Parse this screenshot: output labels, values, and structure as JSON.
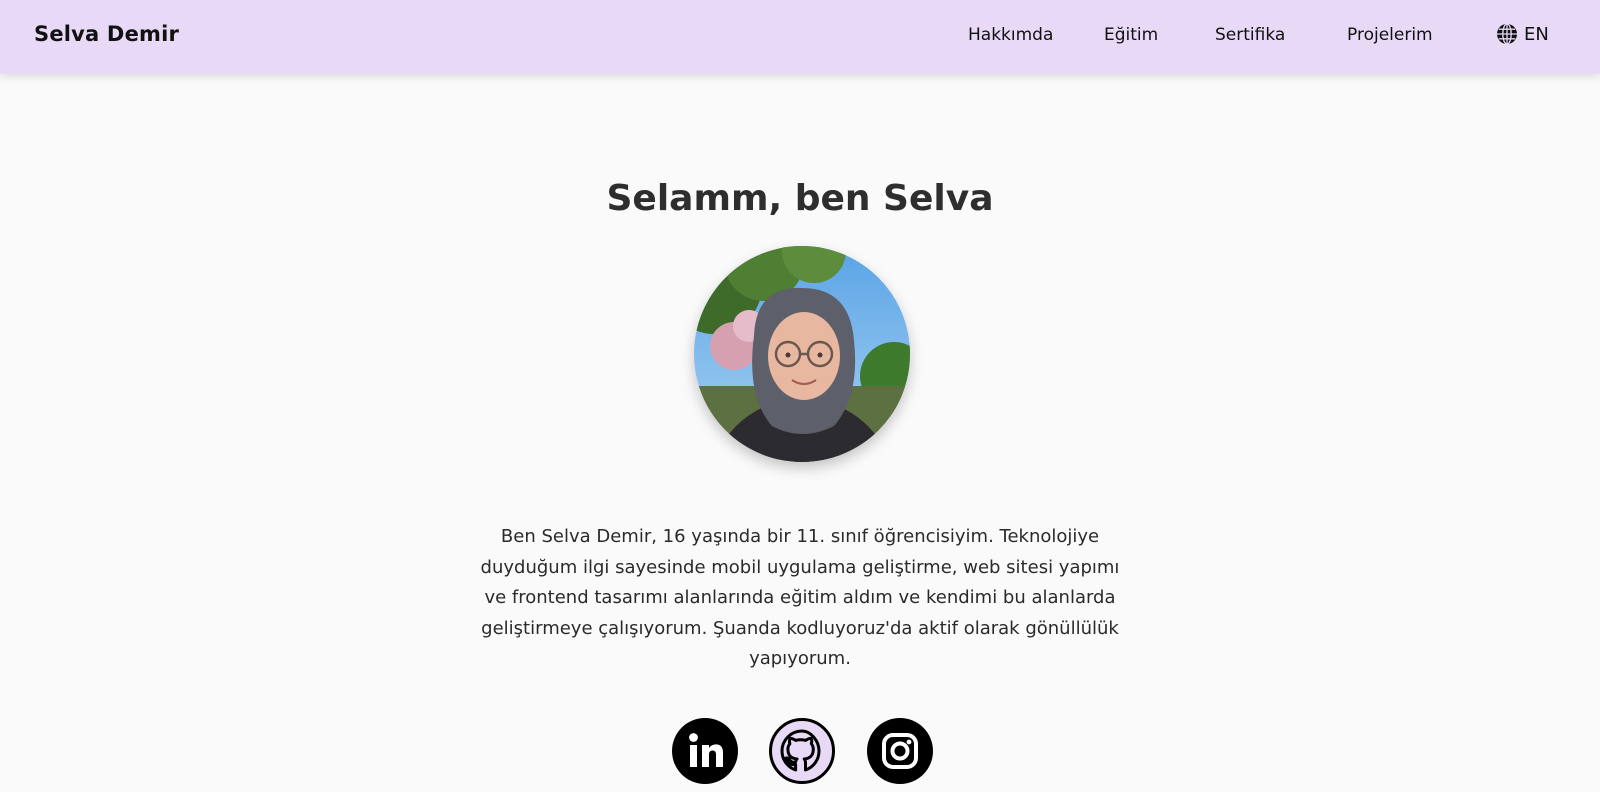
{
  "navbar": {
    "brand": "Selva Demir",
    "links": [
      "Hakkımda",
      "Eğitim",
      "Sertifika",
      "Projelerim"
    ],
    "language": {
      "label": "EN",
      "icon": "globe-icon"
    }
  },
  "hero": {
    "title": "Selamm, ben Selva",
    "bio": "Ben Selva Demir, 16 yaşında bir 11. sınıf öğrencisiyim. Teknolojiye duyduğum ilgi sayesinde mobil uygulama geliştirme, web sitesi yapımı ve frontend tasarımı alanlarında eğitim aldım ve kendimi bu alanlarda geliştirmeye çalışıyorum. Şuanda kodluyoruz'da aktif olarak gönüllülük yapıyorum."
  },
  "social": [
    {
      "icon": "linkedin-icon"
    },
    {
      "icon": "github-icon"
    },
    {
      "icon": "instagram-icon"
    }
  ],
  "colors": {
    "navbar_bg": "#e8d9f6",
    "page_bg": "#fafafa",
    "text": "#2a2a2a"
  }
}
